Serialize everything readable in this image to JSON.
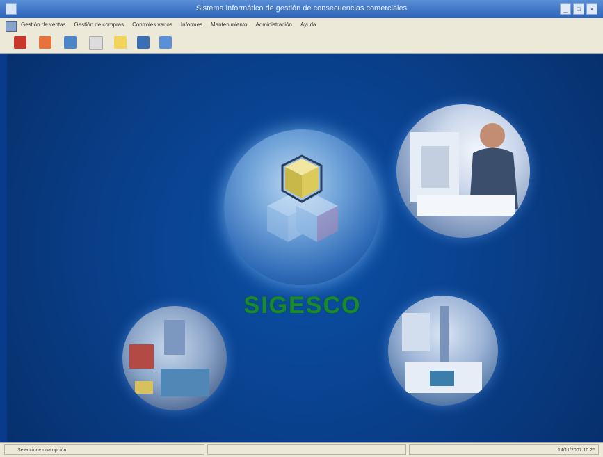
{
  "window": {
    "title": "Sistema informático de gestión de consecuencias comerciales",
    "controls": [
      "_",
      "□",
      "×"
    ]
  },
  "menu": {
    "items": [
      "Gestión de ventas",
      "Gestión de compras",
      "Controles varios",
      "Informes",
      "Mantenimiento",
      "Administración",
      "Ayuda"
    ]
  },
  "toolbar": {
    "buttons": [
      "exit-icon",
      "edit-icon",
      "search-icon",
      "document-icon",
      "folder-icon",
      "save-icon",
      "help-icon"
    ]
  },
  "stage": {
    "logo_text": "SIGESCO"
  },
  "statusbar": {
    "left": "Seleccione una opción",
    "middle": "",
    "right": "14/11/2007 10:25"
  },
  "colors": {
    "background": "#0a3a8c",
    "logo_text": "#1a8a2e"
  }
}
